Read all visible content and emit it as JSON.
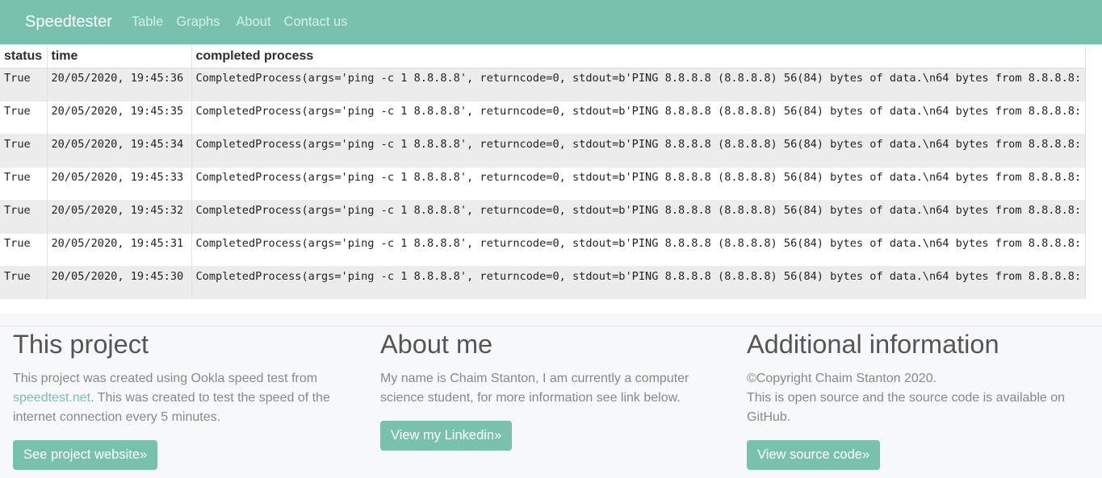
{
  "nav": {
    "brand": "Speedtester",
    "links": [
      "Table",
      "Graphs",
      "About",
      "Contact us"
    ]
  },
  "table": {
    "headers": [
      "status",
      "time",
      "completed process"
    ],
    "rows": [
      [
        "True",
        "20/05/2020, 19:45:36",
        "CompletedProcess(args='ping -c 1 8.8.8.8', returncode=0, stdout=b'PING 8.8.8.8 (8.8.8.8) 56(84) bytes of data.\\n64 bytes from 8.8.8.8:"
      ],
      [
        "True",
        "20/05/2020, 19:45:35",
        "CompletedProcess(args='ping -c 1 8.8.8.8', returncode=0, stdout=b'PING 8.8.8.8 (8.8.8.8) 56(84) bytes of data.\\n64 bytes from 8.8.8.8:"
      ],
      [
        "True",
        "20/05/2020, 19:45:34",
        "CompletedProcess(args='ping -c 1 8.8.8.8', returncode=0, stdout=b'PING 8.8.8.8 (8.8.8.8) 56(84) bytes of data.\\n64 bytes from 8.8.8.8:"
      ],
      [
        "True",
        "20/05/2020, 19:45:33",
        "CompletedProcess(args='ping -c 1 8.8.8.8', returncode=0, stdout=b'PING 8.8.8.8 (8.8.8.8) 56(84) bytes of data.\\n64 bytes from 8.8.8.8:"
      ],
      [
        "True",
        "20/05/2020, 19:45:32",
        "CompletedProcess(args='ping -c 1 8.8.8.8', returncode=0, stdout=b'PING 8.8.8.8 (8.8.8.8) 56(84) bytes of data.\\n64 bytes from 8.8.8.8:"
      ],
      [
        "True",
        "20/05/2020, 19:45:31",
        "CompletedProcess(args='ping -c 1 8.8.8.8', returncode=0, stdout=b'PING 8.8.8.8 (8.8.8.8) 56(84) bytes of data.\\n64 bytes from 8.8.8.8:"
      ],
      [
        "True",
        "20/05/2020, 19:45:30",
        "CompletedProcess(args='ping -c 1 8.8.8.8', returncode=0, stdout=b'PING 8.8.8.8 (8.8.8.8) 56(84) bytes of data.\\n64 bytes from 8.8.8.8:"
      ]
    ]
  },
  "project": {
    "title": "This project",
    "text_before_link": "This project was created using Ookla speed test from ",
    "link": "speedtest.net",
    "text_after_link": ". This was created to test the speed of the internet connection every 5 minutes.",
    "button": "See project website»"
  },
  "about": {
    "title": "About me",
    "text": "My name is Chaim Stanton, I am currently a computer science student, for more information see link below.",
    "button": "View my Linkedin»"
  },
  "additional": {
    "title": "Additional information",
    "copyright": "©Copyright Chaim Stanton 2020.",
    "text": "This is open source and the source code is available on GitHub.",
    "button": "View source code»"
  },
  "colors": {
    "accent": "#78c2ad",
    "heading": "#555555",
    "body_text": "#888888"
  }
}
